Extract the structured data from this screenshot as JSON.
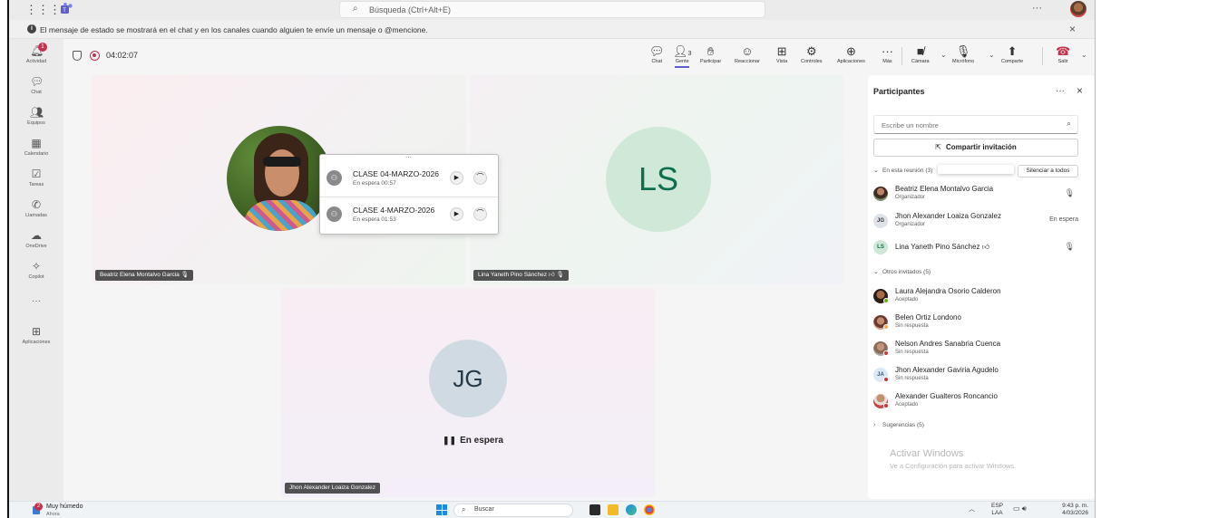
{
  "titlebar": {
    "search_placeholder": "Búsqueda (Ctrl+Alt+E)",
    "more": "···"
  },
  "banner": {
    "text": "El mensaje de estado se mostrará en el chat y en los canales cuando alguien te envíe un mensaje o @mencione.",
    "close": "×"
  },
  "rail": {
    "items": [
      {
        "label": "Actividad",
        "icon": "bell-icon",
        "badge": "1"
      },
      {
        "label": "Chat",
        "icon": "chat-icon"
      },
      {
        "label": "Equipos",
        "icon": "teams-icon"
      },
      {
        "label": "Calendario",
        "icon": "calendar-icon"
      },
      {
        "label": "Tareas",
        "icon": "tasks-icon"
      },
      {
        "label": "Llamadas",
        "icon": "phone-icon"
      },
      {
        "label": "OneDrive",
        "icon": "cloud-icon"
      },
      {
        "label": "Copilot",
        "icon": "copilot-icon"
      },
      {
        "label": "···",
        "icon": "more-icon"
      },
      {
        "label": "Aplicaciones",
        "icon": "plus-icon"
      }
    ]
  },
  "meeting": {
    "timer": "04:02:07",
    "toolbar": {
      "chat": "Chat",
      "people": "Gente",
      "people_count": "3",
      "raise": "Participar",
      "react": "Reaccionar",
      "view": "Vista",
      "controls": "Controles",
      "apps": "Aplicaciones",
      "more": "Más",
      "camera": "Cámara",
      "mic": "Micrófono",
      "share": "Comparte",
      "leave": "Salir"
    },
    "tiles": {
      "beatriz": "Beatriz Elena Montalvo Garcia",
      "lina": "Lina Yaneth Pino Sánchez",
      "jhon": "Jhon Alexander Loaiza Gonzalez",
      "ls_initials": "LS",
      "jg_initials": "JG",
      "hold_text": "En espera"
    },
    "hold_calls": [
      {
        "title": "CLASE 04-MARZO-2026",
        "status": "En espera  00:57"
      },
      {
        "title": "CLASE 4-MARZO-2026",
        "status": "En espera  01:53"
      }
    ]
  },
  "panel": {
    "title": "Participantes",
    "search_placeholder": "Escribe un nombre",
    "share_invite": "Compartir invitación",
    "in_meeting_header": "En esta reunión (3)",
    "mute_all": "Silenciar a todos",
    "in_meeting": [
      {
        "name": "Beatriz Elena Montalvo Garcia",
        "role": "Organizador",
        "right": ""
      },
      {
        "name": "Jhon Alexander Loaiza Gonzalez",
        "role": "Organizador",
        "right": "En espera",
        "initials": "JG"
      },
      {
        "name": "Lina Yaneth Pino Sánchez",
        "role": "",
        "right": "",
        "initials": "LS"
      }
    ],
    "others_header": "Otros invitados (5)",
    "others": [
      {
        "name": "Laura Alejandra Osorio Calderon",
        "role": "Aceptado"
      },
      {
        "name": "Belen Ortiz Londono",
        "role": "Sin respuesta"
      },
      {
        "name": "Nelson Andres Sanabria Cuenca",
        "role": "Sin respuesta"
      },
      {
        "name": "Jhon Alexander Gaviria Agudelo",
        "role": "Sin respuesta",
        "initials": "JA"
      },
      {
        "name": "Alexander Gualteros Roncancio",
        "role": "Aceptado"
      }
    ],
    "suggestions_header": "Sugerencias (5)",
    "watermark_title": "Activar Windows",
    "watermark_sub": "Ve a Configuración para activar Windows."
  },
  "taskbar": {
    "weather": "Muy húmedo",
    "weather_sub": "Ahora",
    "weather_badge": "2",
    "search": "Buscar",
    "lang_top": "ESP",
    "lang_bottom": "LAA",
    "time": "9:43 p. m.",
    "date": "4/03/2026"
  },
  "colors": {
    "accent": "#5b5fc7",
    "leave": "#c4314b",
    "rail_bg": "#ebebeb"
  }
}
